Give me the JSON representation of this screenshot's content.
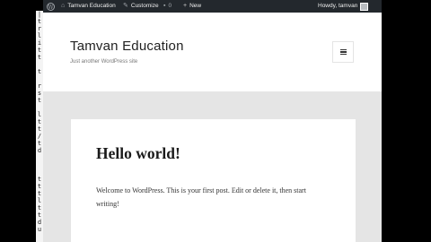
{
  "admin_bar": {
    "site_name": "Tamvan Education",
    "customize_label": "Customize",
    "comments_count": "0",
    "new_label": "New",
    "greeting": "Howdy, tamvan"
  },
  "site": {
    "title": "Tamvan Education",
    "tagline": "Just another WordPress site"
  },
  "post": {
    "title": "Hello world!",
    "body": "Welcome to WordPress. This is your first post. Edit or delete it, then start writing!"
  },
  "side_glyphs": [
    "|",
    "t",
    "r",
    "l",
    "i",
    "t",
    "t",
    "",
    "t",
    "",
    "r",
    "s",
    "t",
    "",
    "l",
    "t",
    "t",
    "/",
    "t",
    "d",
    "",
    "",
    "",
    "t",
    "t",
    "t",
    "l",
    "t",
    "t",
    "d",
    "u"
  ],
  "colors": {
    "admin_bar": "#23282d",
    "page_background": "#e5e5e5",
    "card_background": "#ffffff"
  }
}
